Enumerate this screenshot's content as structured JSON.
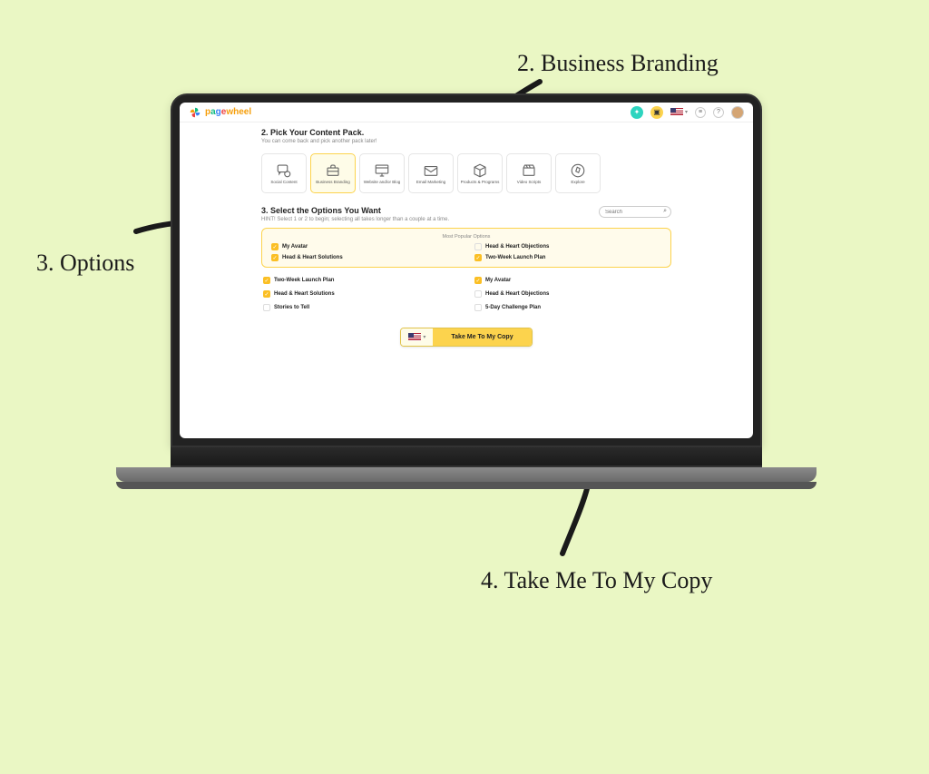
{
  "annotations": {
    "business_branding": "2. Business Branding",
    "options": "3. Options",
    "take_me": "4. Take Me To My Copy"
  },
  "header": {
    "brand_name_p": "p",
    "brand_name_a": "a",
    "brand_name_g": "g",
    "brand_name_e": "e",
    "brand_name_rest": "wheel",
    "language": "us"
  },
  "section2": {
    "title": "2. Pick Your Content Pack.",
    "subtitle": "You can come back and pick another pack later!"
  },
  "packs": [
    {
      "label": "Social Content"
    },
    {
      "label": "Business Branding"
    },
    {
      "label": "Website and/or Blog"
    },
    {
      "label": "Email Marketing"
    },
    {
      "label": "Products & Programs"
    },
    {
      "label": "Video Scripts"
    },
    {
      "label": "Explore"
    }
  ],
  "section3": {
    "title": "3. Select the Options You Want",
    "hint": "HINT! Select 1 or 2 to begin; selecting all takes longer than a couple at a time.",
    "search_placeholder": "Search"
  },
  "popular": {
    "heading": "Most Popular Options",
    "items": [
      {
        "label": "My Avatar",
        "checked": true
      },
      {
        "label": "Head & Heart Objections",
        "checked": false
      },
      {
        "label": "Head & Heart Solutions",
        "checked": true
      },
      {
        "label": "Two-Week Launch Plan",
        "checked": true
      }
    ]
  },
  "all_options": [
    {
      "label": "Two-Week Launch Plan",
      "checked": true
    },
    {
      "label": "My Avatar",
      "checked": true
    },
    {
      "label": "Head & Heart Solutions",
      "checked": true
    },
    {
      "label": "Head & Heart Objections",
      "checked": false
    },
    {
      "label": "Stories to Tell",
      "checked": false
    },
    {
      "label": "5-Day Challenge Plan",
      "checked": false
    }
  ],
  "cta": {
    "label": "Take Me To My Copy"
  }
}
